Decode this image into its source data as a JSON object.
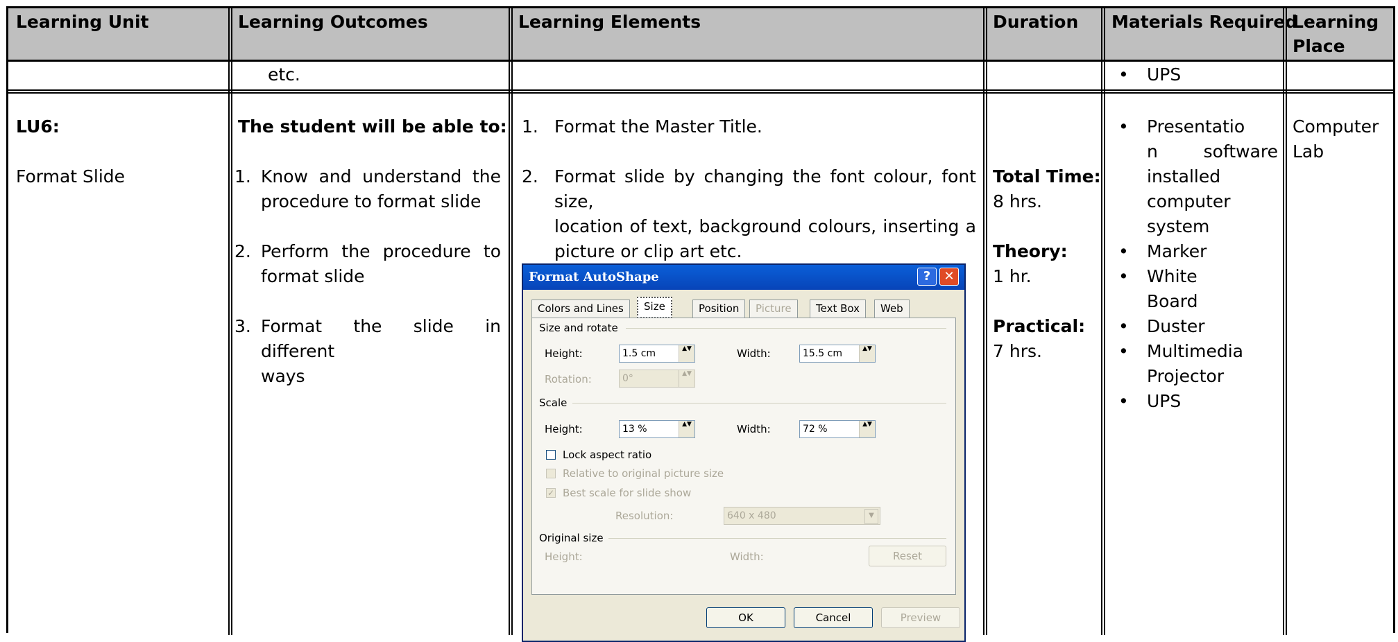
{
  "headers": {
    "learning_unit": "Learning Unit",
    "learning_outcomes": "Learning Outcomes",
    "learning_elements": "Learning Elements",
    "duration": "Duration",
    "materials_required": "Materials Required",
    "learning_place_line1": "Learning",
    "learning_place_line2": "Place"
  },
  "row1": {
    "outcomes_cont": "etc.",
    "materials": [
      "UPS"
    ]
  },
  "row2": {
    "unit_code": "LU6:",
    "unit_name": "Format Slide",
    "outcomes_intro": "The student will be able to:",
    "outcomes": [
      {
        "num": "1.",
        "line1": "Know and understand the",
        "line2": "procedure to format slide"
      },
      {
        "num": "2.",
        "line1": "Perform the procedure to",
        "line2": "format slide"
      },
      {
        "num": "3.",
        "line1": "Format the slide in different",
        "line2": "ways"
      }
    ],
    "elements": [
      {
        "num": "1.",
        "lines": [
          "Format the Master Title."
        ]
      },
      {
        "num": "2.",
        "lines": [
          "Format slide by changing the font colour, font size,",
          "location of text, background colours, inserting a",
          "picture or clip art etc."
        ]
      }
    ],
    "duration": {
      "total_label": "Total Time:",
      "total_value": "8 hrs.",
      "theory_label": "Theory:",
      "theory_value": "1 hr.",
      "practical_label": "Practical:",
      "practical_value": "7 hrs."
    },
    "materials": [
      {
        "lines": [
          "Presentatio",
          "n software",
          "installed",
          "computer",
          "system"
        ]
      },
      {
        "lines": [
          "Marker"
        ]
      },
      {
        "lines": [
          "White",
          "Board"
        ]
      },
      {
        "lines": [
          "Duster"
        ]
      },
      {
        "lines": [
          "Multimedia",
          "Projector"
        ]
      },
      {
        "lines": [
          "UPS"
        ]
      }
    ],
    "place_line1": "Computer",
    "place_line2": "Lab"
  },
  "dialog": {
    "title": "Format AutoShape",
    "help_glyph": "?",
    "close_glyph": "✕",
    "tabs": [
      "Colors and Lines",
      "Size",
      "Position",
      "Picture",
      "Text Box",
      "Web"
    ],
    "active_tab": "Size",
    "size_rotate_label": "Size and rotate",
    "height_label": "Height:",
    "width_label": "Width:",
    "rotation_label": "Rotation:",
    "sr_height": "1.5 cm",
    "sr_width": "15.5 cm",
    "rotation": "0°",
    "scale_label": "Scale",
    "scale_height": "13 %",
    "scale_width": "72 %",
    "lock_aspect": "Lock aspect ratio",
    "relative_original": "Relative to original picture size",
    "best_scale": "Best scale for slide show",
    "resolution_label": "Resolution:",
    "resolution": "640 x 480",
    "original_size_label": "Original size",
    "orig_height_label": "Height:",
    "orig_width_label": "Width:",
    "reset": "Reset",
    "ok": "OK",
    "cancel": "Cancel",
    "preview": "Preview",
    "spin_glyph": "▲▼",
    "check_glyph": "✓",
    "dropdown_glyph": "▼"
  }
}
